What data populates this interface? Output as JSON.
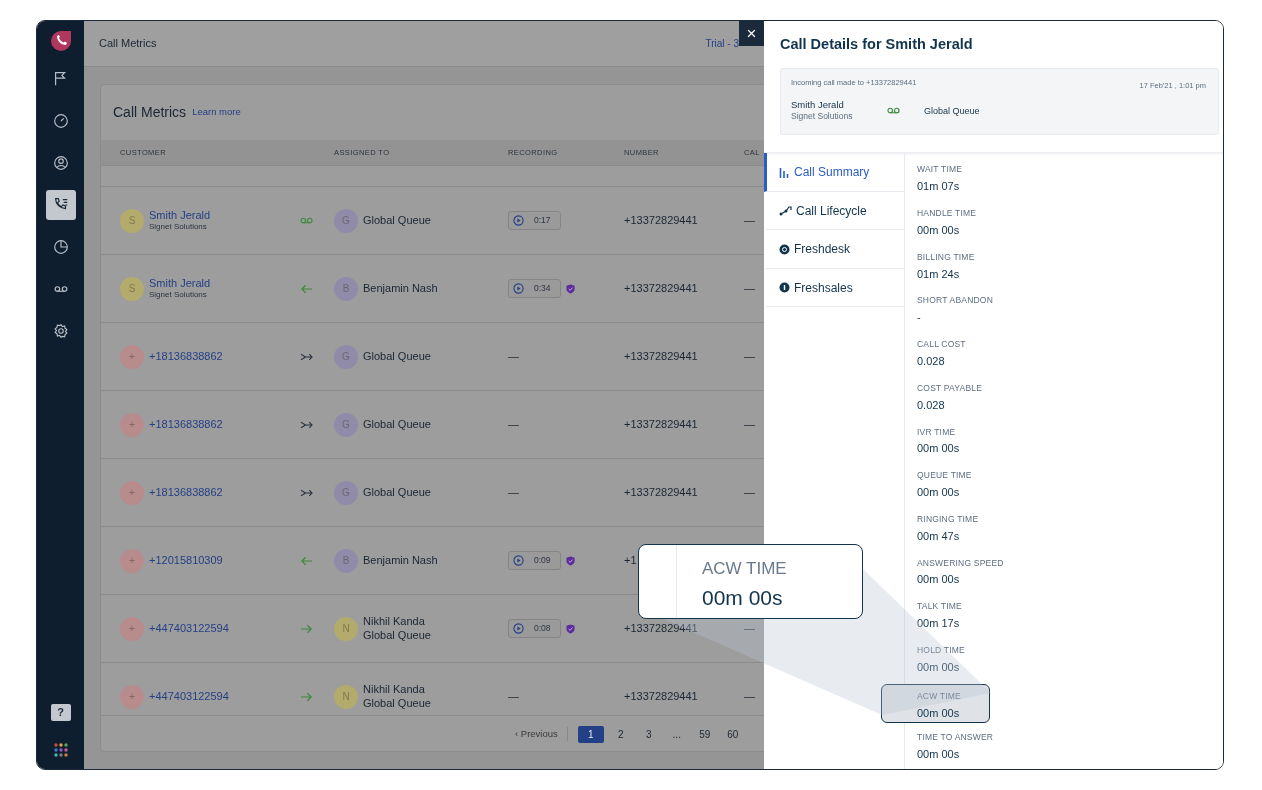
{
  "sidebar": {
    "items": [
      {
        "selected": false
      },
      {
        "selected": false
      },
      {
        "selected": false
      },
      {
        "selected": true
      },
      {
        "selected": false
      },
      {
        "selected": false
      },
      {
        "selected": false
      }
    ],
    "help_label": "?"
  },
  "header": {
    "title": "Call Metrics",
    "trial": "Trial - 3"
  },
  "card": {
    "title": "Call Metrics",
    "link": "Learn more"
  },
  "table": {
    "columns": [
      "CUSTOMER",
      "ASSIGNED TO",
      "RECORDING",
      "NUMBER",
      "CAL"
    ],
    "rows": [
      {
        "kind": "voicemail",
        "avatar": "S",
        "color": "#b3ab6c",
        "customer": "Smith Jerald",
        "company": "Signet Solutions",
        "assignee": {
          "avatar": "G",
          "color": "#8f8ba9",
          "name": "Global Queue"
        },
        "recording": {
          "kind": "player",
          "duration": "0:17",
          "verified": false
        },
        "number": "+13372829441",
        "column_5": "—"
      },
      {
        "kind": "incoming",
        "avatar": "S",
        "color": "#b3ab6c",
        "customer": "Smith Jerald",
        "company": "Signet Solutions",
        "assignee": {
          "avatar": "B",
          "color": "#8f8ba9",
          "name": "Benjamin Nash"
        },
        "recording": {
          "kind": "player",
          "duration": "0:34",
          "verified": true
        },
        "number": "+13372829441",
        "column_5": "—"
      },
      {
        "kind": "missed",
        "avatar": "+",
        "color": "#b88c8c",
        "customer": "+18136838862",
        "assignee": {
          "avatar": "G",
          "color": "#8f8ba9",
          "name": "Global Queue"
        },
        "recording": {
          "kind": "none",
          "text": "—"
        },
        "number": "+13372829441",
        "column_5": "—"
      },
      {
        "kind": "missed",
        "avatar": "+",
        "color": "#b88c8c",
        "customer": "+18136838862",
        "assignee": {
          "avatar": "G",
          "color": "#8f8ba9",
          "name": "Global Queue"
        },
        "recording": {
          "kind": "none",
          "text": "—"
        },
        "number": "+13372829441",
        "column_5": "—"
      },
      {
        "kind": "missed",
        "avatar": "+",
        "color": "#b88c8c",
        "customer": "+18136838862",
        "assignee": {
          "avatar": "G",
          "color": "#8f8ba9",
          "name": "Global Queue"
        },
        "recording": {
          "kind": "none",
          "text": "—"
        },
        "number": "+13372829441",
        "column_5": "—"
      },
      {
        "kind": "incoming",
        "avatar": "+",
        "color": "#b88c8c",
        "customer": "+12015810309",
        "assignee": {
          "avatar": "B",
          "color": "#8f8ba9",
          "name": "Benjamin Nash"
        },
        "recording": {
          "kind": "player",
          "duration": "0:09",
          "verified": true
        },
        "number": "+1"
      },
      {
        "kind": "outgoing",
        "avatar": "+",
        "color": "#b88c8c",
        "customer": "+447403122594",
        "assignee": {
          "avatar": "N",
          "color": "#b3ab6c",
          "name": "Nikhil Kanda",
          "team": "Global Queue"
        },
        "recording": {
          "kind": "player",
          "duration": "0:08",
          "verified": true
        },
        "number": "+13372829441",
        "column_5": "—"
      },
      {
        "kind": "outgoing",
        "avatar": "+",
        "color": "#b88c8c",
        "customer": "+447403122594",
        "assignee": {
          "avatar": "N",
          "color": "#b3ab6c",
          "name": "Nikhil Kanda",
          "team": "Global Queue"
        },
        "recording": {
          "kind": "none",
          "text": "—"
        },
        "number": "+13372829441",
        "column_5": "—"
      }
    ]
  },
  "pagination": {
    "previous": "‹ Previous",
    "pages": [
      {
        "label": "1",
        "selected": true
      },
      {
        "label": "2",
        "selected": false
      },
      {
        "label": "3",
        "selected": false
      },
      {
        "label": "...",
        "selected": false
      },
      {
        "label": "59",
        "selected": false
      },
      {
        "label": "60",
        "selected": false
      }
    ]
  },
  "drawer": {
    "close": "×",
    "title": "Call Details for Smith Jerald",
    "info": {
      "kind": "voicemail",
      "line": "Incoming call made to +13372829441",
      "date": "17 Feb'21 , 1:01 pm",
      "name": "Smith Jerald",
      "company": "Signet Solutions",
      "queue": "Global Queue"
    },
    "tabs": [
      {
        "label": "Call Summary",
        "selected": true
      },
      {
        "label": "Call Lifecycle",
        "selected": false
      },
      {
        "label": "Freshdesk",
        "selected": false
      },
      {
        "label": "Freshsales",
        "selected": false
      }
    ],
    "metrics": [
      {
        "label": "WAIT TIME",
        "value": "01m 07s",
        "highlighted": false
      },
      {
        "label": "HANDLE TIME",
        "value": "00m 00s",
        "highlighted": false
      },
      {
        "label": "BILLING TIME",
        "value": "01m 24s",
        "highlighted": false
      },
      {
        "label": "SHORT ABANDON",
        "value": "-",
        "highlighted": false
      },
      {
        "label": "CALL COST",
        "value": "0.028",
        "highlighted": false
      },
      {
        "label": "COST PAYABLE",
        "value": "0.028",
        "highlighted": false
      },
      {
        "label": "IVR TIME",
        "value": "00m 00s",
        "highlighted": false
      },
      {
        "label": "QUEUE TIME",
        "value": "00m 00s",
        "highlighted": false
      },
      {
        "label": "RINGING TIME",
        "value": "00m 47s",
        "highlighted": false
      },
      {
        "label": "ANSWERING SPEED",
        "value": "00m 00s",
        "highlighted": false
      },
      {
        "label": "TALK TIME",
        "value": "00m 17s",
        "highlighted": false
      },
      {
        "label": "HOLD TIME",
        "value": "00m 00s",
        "highlighted": false
      },
      {
        "label": "ACW TIME",
        "value": "00m 00s",
        "highlighted": true
      },
      {
        "label": "TIME TO ANSWER",
        "value": "00m 00s",
        "highlighted": false
      }
    ]
  },
  "callout": {
    "label": "ACW TIME",
    "value": "00m 00s"
  }
}
